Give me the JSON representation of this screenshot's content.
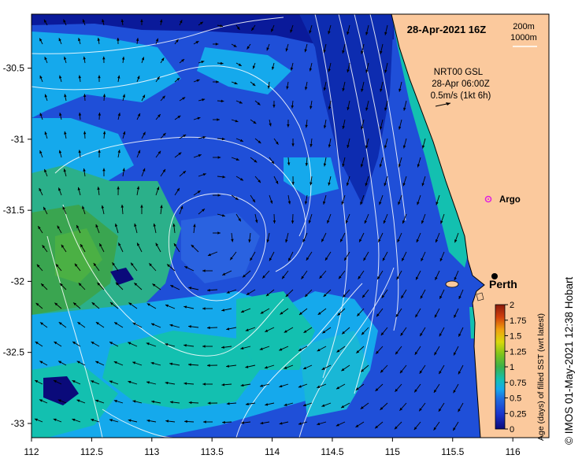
{
  "map": {
    "title": "28-Apr-2021 16Z",
    "scale_bar": {
      "line1": "200m",
      "line2": "1000m"
    },
    "current_info": {
      "line1": "NRT00 GSL",
      "line2": "28-Apr 06:00Z",
      "line3": "0.5m/s (1kt 6h)"
    },
    "places": [
      {
        "name": "Argo",
        "lon": 115.78,
        "lat": -31.45,
        "marker": "argo-float"
      },
      {
        "name": "Perth",
        "lon": 115.86,
        "lat": -31.95,
        "marker": "city"
      }
    ],
    "x_axis": {
      "ticks": [
        "112",
        "112.5",
        "113",
        "113.5",
        "114",
        "114.5",
        "115",
        "115.5",
        "116"
      ]
    },
    "y_axis": {
      "ticks": [
        "-30.5",
        "-31",
        "-31.5",
        "-32",
        "-32.5",
        "-33"
      ]
    },
    "lon_range": [
      112,
      116.3
    ],
    "lat_range": [
      -33.1,
      -30.12
    ],
    "colors": {
      "land": "#fbc99d",
      "sst_age_scale": [
        "#0a0a7a",
        "#1a33cc",
        "#1f4fd8",
        "#15a9ec",
        "#13c0b0",
        "#3cb14a",
        "#7dc41d",
        "#d9d80c",
        "#f0a010",
        "#d2400c",
        "#8b1a0c"
      ]
    }
  },
  "colorbar": {
    "label": "Age (days) of filled SST (wrt latest)",
    "ticks": [
      "2",
      "1.75",
      "1.5",
      "1.25",
      "1",
      "0.75",
      "0.5",
      "0.25",
      "0"
    ]
  },
  "credit": "© IMOS 01-May-2021 12:38 Hobart"
}
